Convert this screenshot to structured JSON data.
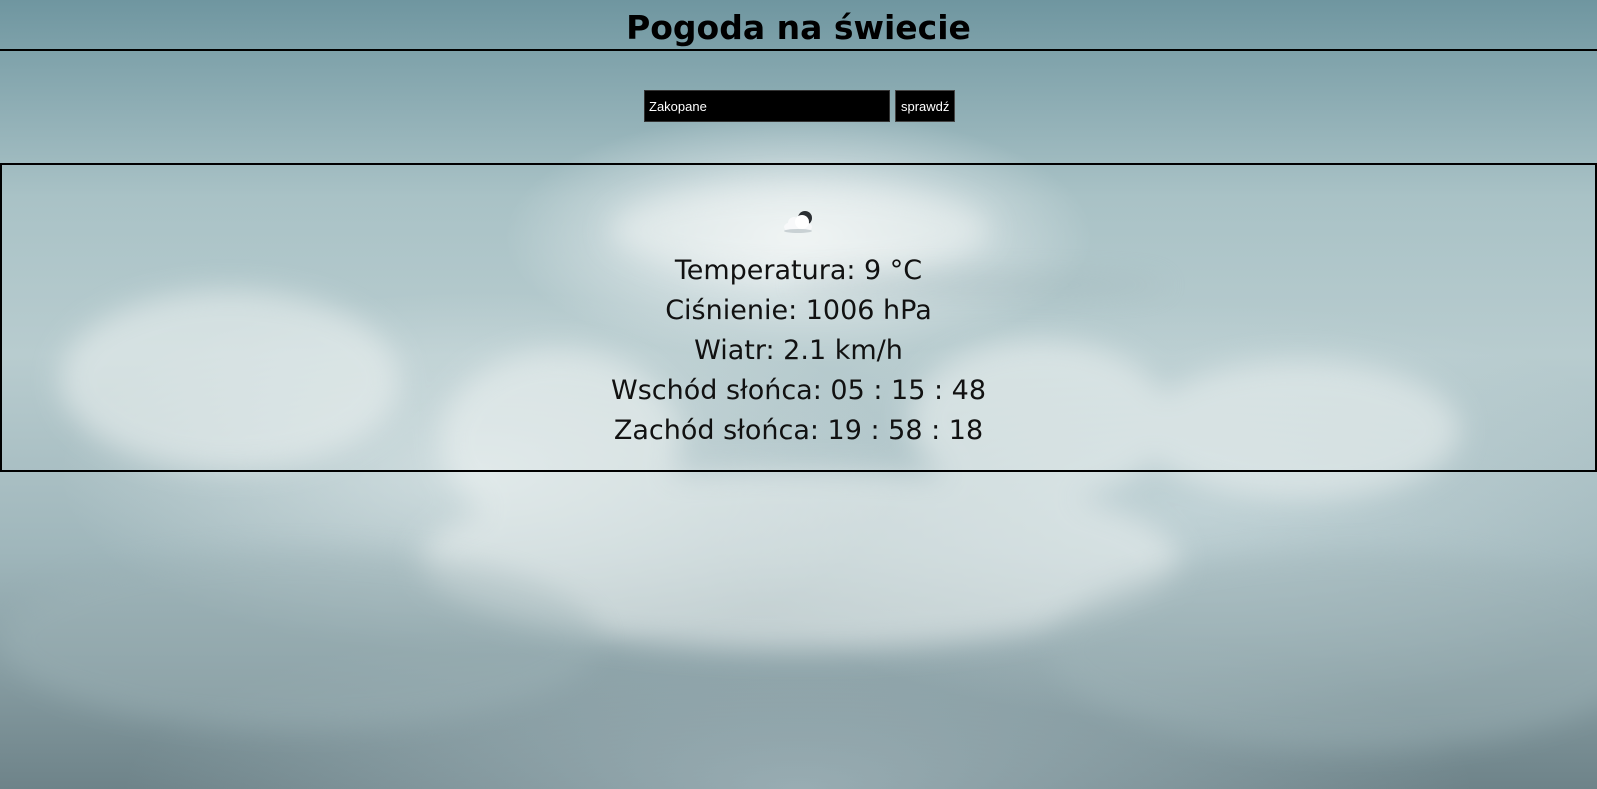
{
  "header": {
    "title": "Pogoda na świecie"
  },
  "search": {
    "value": "Zakopane",
    "button_label": "sprawdź"
  },
  "weather": {
    "icon": "cloud-partly-cloudy-icon",
    "temperature": "Temperatura: 9 °C",
    "pressure": "Ciśnienie: 1006 hPa",
    "wind": "Wiatr: 2.1 km/h",
    "sunrise": "Wschód słońca: 05 : 15 : 48",
    "sunset": "Zachód słońca: 19 : 58 : 18"
  }
}
